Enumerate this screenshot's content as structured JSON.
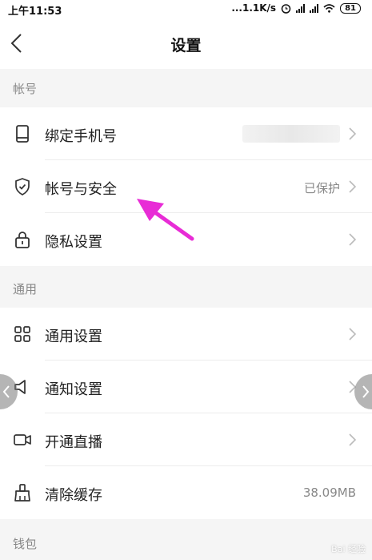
{
  "status_bar": {
    "time": "上午11:53",
    "network_speed": "...1.1K/s",
    "battery": "81",
    "icons": [
      "alarm-icon",
      "signal-icon",
      "signal-icon",
      "wifi-icon",
      "battery-icon"
    ]
  },
  "header": {
    "title": "设置",
    "back_icon": "chevron-left-icon"
  },
  "sections": {
    "account": {
      "label": "帐号",
      "items": [
        {
          "label": "绑定手机号",
          "value": "",
          "icon": "phone-icon"
        },
        {
          "label": "帐号与安全",
          "value": "已保护",
          "icon": "shield-check-icon"
        },
        {
          "label": "隐私设置",
          "value": "",
          "icon": "lock-icon"
        }
      ]
    },
    "general": {
      "label": "通用",
      "items": [
        {
          "label": "通用设置",
          "value": "",
          "icon": "grid-icon"
        },
        {
          "label": "通知设置",
          "value": "",
          "icon": "speaker-icon"
        },
        {
          "label": "开通直播",
          "value": "",
          "icon": "video-camera-icon"
        },
        {
          "label": "清除缓存",
          "value": "38.09MB",
          "icon": "broom-icon"
        }
      ]
    },
    "wallet": {
      "label": "钱包"
    }
  },
  "annotation": {
    "arrow_color": "#e82cd6"
  },
  "watermark": {
    "text": "Bai 经验"
  }
}
